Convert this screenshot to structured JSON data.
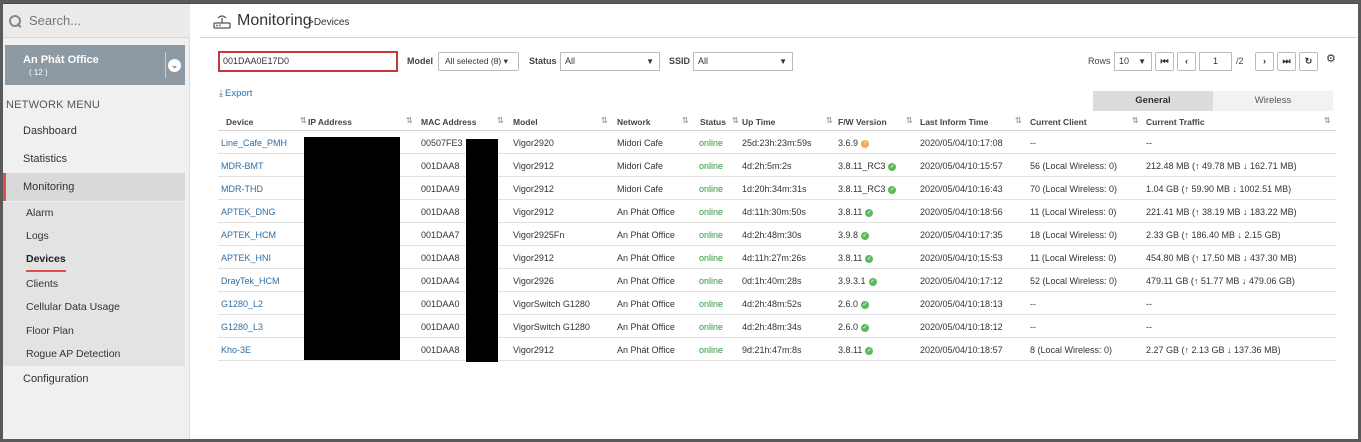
{
  "sidebar": {
    "search_placeholder": "Search...",
    "site": {
      "name": "An Phát Office",
      "count": "( 12 )"
    },
    "menu_heading": "NETWORK MENU",
    "items": [
      {
        "label": "Dashboard"
      },
      {
        "label": "Statistics"
      },
      {
        "label": "Monitoring"
      },
      {
        "label": "Configuration"
      }
    ],
    "monitoring_sub": [
      "Alarm",
      "Logs",
      "Devices",
      "Clients",
      "Cellular Data Usage",
      "Floor Plan",
      "Rogue AP Detection"
    ]
  },
  "header": {
    "title": "Monitoring",
    "breadcrumb": ">Devices"
  },
  "filters": {
    "search_value": "001DAA0E17D0",
    "model_label": "Model",
    "model_value": "All selected (8)",
    "status_label": "Status",
    "status_value": "All",
    "ssid_label": "SSID",
    "ssid_value": "All"
  },
  "pagination": {
    "rows_label": "Rows",
    "rows_value": "10",
    "page": "1",
    "total": "/2"
  },
  "export_label": "Export",
  "tabs": {
    "general": "General",
    "wireless": "Wireless"
  },
  "table": {
    "headers": [
      "Device",
      "IP Address",
      "MAC Address",
      "Model",
      "Network",
      "Status",
      "Up Time",
      "F/W Version",
      "Last Inform Time",
      "Current Client",
      "Current Traffic"
    ],
    "rows": [
      {
        "device": "Line_Cafe_PMH",
        "mac": "00507FE3",
        "model": "Vigor2920",
        "network": "Midori Cafe",
        "status": "online",
        "uptime": "25d:23h:23m:59s",
        "fw": "3.6.9",
        "fw_state": "warn",
        "inform": "2020/05/04/10:17:08",
        "client": "--",
        "traffic": "--"
      },
      {
        "device": "MDR-BMT",
        "mac": "001DAA8",
        "model": "Vigor2912",
        "network": "Midori Cafe",
        "status": "online",
        "uptime": "4d:2h:5m:2s",
        "fw": "3.8.11_RC3",
        "fw_state": "ok",
        "inform": "2020/05/04/10:15:57",
        "client": "56 (Local Wireless: 0)",
        "traffic": "212.48 MB (↑ 49.78 MB ↓ 162.71 MB)"
      },
      {
        "device": "MDR-THD",
        "mac": "001DAA9",
        "model": "Vigor2912",
        "network": "Midori Cafe",
        "status": "online",
        "uptime": "1d:20h:34m:31s",
        "fw": "3.8.11_RC3",
        "fw_state": "ok",
        "inform": "2020/05/04/10:16:43",
        "client": "70 (Local Wireless: 0)",
        "traffic": "1.04 GB (↑ 59.90 MB ↓ 1002.51 MB)"
      },
      {
        "device": "APTEK_DNG",
        "mac": "001DAA8",
        "model": "Vigor2912",
        "network": "An Phát Office",
        "status": "online",
        "uptime": "4d:11h:30m:50s",
        "fw": "3.8.11",
        "fw_state": "ok",
        "inform": "2020/05/04/10:18:56",
        "client": "11 (Local Wireless: 0)",
        "traffic": "221.41 MB (↑ 38.19 MB ↓ 183.22 MB)"
      },
      {
        "device": "APTEK_HCM",
        "mac": "001DAA7",
        "model": "Vigor2925Fn",
        "network": "An Phát Office",
        "status": "online",
        "uptime": "4d:2h:48m:30s",
        "fw": "3.9.8",
        "fw_state": "ok",
        "inform": "2020/05/04/10:17:35",
        "client": "18 (Local Wireless: 0)",
        "traffic": "2.33 GB (↑ 186.40 MB ↓ 2.15 GB)"
      },
      {
        "device": "APTEK_HNI",
        "mac": "001DAA8",
        "model": "Vigor2912",
        "network": "An Phát Office",
        "status": "online",
        "uptime": "4d:11h:27m:26s",
        "fw": "3.8.11",
        "fw_state": "ok",
        "inform": "2020/05/04/10:15:53",
        "client": "11 (Local Wireless: 0)",
        "traffic": "454.80 MB (↑ 17.50 MB ↓ 437.30 MB)"
      },
      {
        "device": "DrayTek_HCM",
        "mac": "001DAA4",
        "model": "Vigor2926",
        "network": "An Phát Office",
        "status": "online",
        "uptime": "0d:1h:40m:28s",
        "fw": "3.9.3.1",
        "fw_state": "ok",
        "inform": "2020/05/04/10:17:12",
        "client": "52 (Local Wireless: 0)",
        "traffic": "479.11 GB (↑ 51.77 MB ↓ 479.06 GB)"
      },
      {
        "device": "G1280_L2",
        "mac": "001DAA0",
        "model": "VigorSwitch G1280",
        "network": "An Phát Office",
        "status": "online",
        "uptime": "4d:2h:48m:52s",
        "fw": "2.6.0",
        "fw_state": "ok",
        "inform": "2020/05/04/10:18:13",
        "client": "--",
        "traffic": "--"
      },
      {
        "device": "G1280_L3",
        "mac": "001DAA0",
        "model": "VigorSwitch G1280",
        "network": "An Phát Office",
        "status": "online",
        "uptime": "4d:2h:48m:34s",
        "fw": "2.6.0",
        "fw_state": "ok",
        "inform": "2020/05/04/10:18:12",
        "client": "--",
        "traffic": "--"
      },
      {
        "device": "Kho-3E",
        "mac": "001DAA8",
        "model": "Vigor2912",
        "network": "An Phát Office",
        "status": "online",
        "uptime": "9d:21h:47m:8s",
        "fw": "3.8.11",
        "fw_state": "ok",
        "inform": "2020/05/04/10:18:57",
        "client": "8 (Local Wireless: 0)",
        "traffic": "2.27 GB (↑ 2.13 GB ↓ 137.36 MB)"
      }
    ]
  },
  "colors": {
    "accent_red": "#d9534f",
    "link_blue": "#2f6da3",
    "online_green": "#2c9a3a",
    "site_box": "#8e9aa3"
  }
}
